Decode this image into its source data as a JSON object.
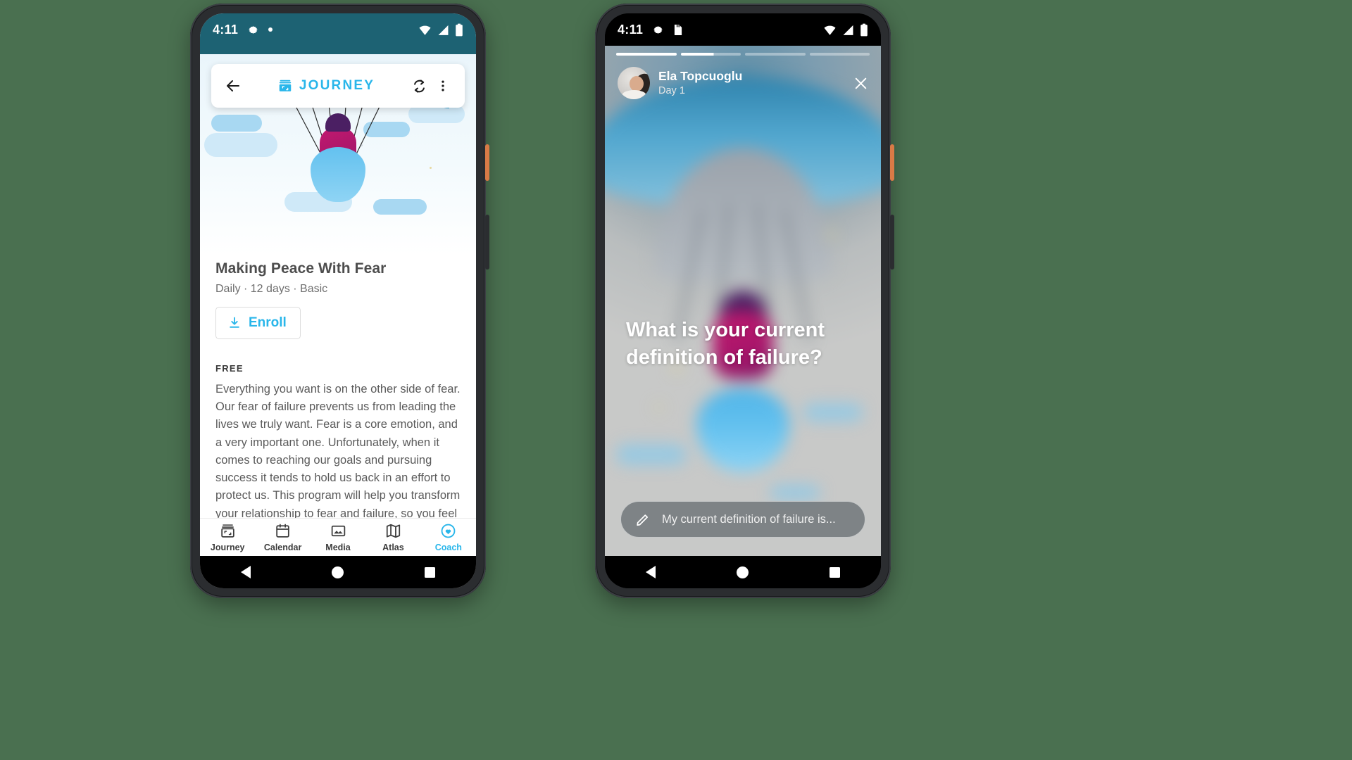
{
  "background_color": "#4a7050",
  "phone1": {
    "status_bar": {
      "time": "4:11",
      "icons": [
        "gear-icon",
        "dot-indicator"
      ],
      "right_icons": [
        "wifi-icon",
        "signal-icon",
        "battery-icon"
      ],
      "background_color": "#1d6273"
    },
    "app_bar": {
      "back_label": "back-arrow",
      "logo": "journey-box-icon",
      "title": "JOURNEY",
      "title_color": "#29b6ea",
      "sync_label": "sync-icon",
      "overflow_label": "more-vert-icon"
    },
    "course": {
      "title": "Making Peace With Fear",
      "meta": "Daily · 12 days · Basic",
      "enroll_label": "Enroll",
      "enroll_color": "#29b6ea",
      "free_tag": "FREE",
      "description": "Everything you want is on the other side of fear. Our fear of failure prevents us from leading the lives we truly want. Fear is a core emotion, and a very important one. Unfortunately, when it comes to reaching our goals and pursuing success it tends to hold us back in an effort to protect us. This program will help you transform your relationship to fear and failure, so you feel confident and empowered to take action towards what you want most."
    },
    "bottom_nav": {
      "active": "Coach",
      "active_color": "#29b6ea",
      "items": [
        {
          "label": "Journey",
          "icon": "journey-box-icon"
        },
        {
          "label": "Calendar",
          "icon": "calendar-icon"
        },
        {
          "label": "Media",
          "icon": "image-icon"
        },
        {
          "label": "Atlas",
          "icon": "map-icon"
        },
        {
          "label": "Coach",
          "icon": "heart-circle-icon"
        }
      ]
    },
    "system_nav": [
      "back-triangle-icon",
      "home-circle-icon",
      "recents-square-icon"
    ]
  },
  "phone2": {
    "status_bar": {
      "time": "4:11",
      "icons": [
        "gear-icon",
        "sd-card-icon"
      ],
      "right_icons": [
        "wifi-icon",
        "signal-icon",
        "battery-icon"
      ],
      "background_color": "#000000"
    },
    "story": {
      "progress": [
        {
          "state": "done"
        },
        {
          "state": "partial"
        },
        {
          "state": "empty"
        },
        {
          "state": "empty"
        }
      ],
      "author_name": "Ela Topcuoglu",
      "day_label": "Day 1",
      "close_label": "close-icon",
      "question": "What is your current definition of failure?",
      "reply_placeholder": "My current definition of failure is...",
      "reply_icon": "pencil-icon"
    },
    "system_nav": [
      "back-triangle-icon",
      "home-circle-icon",
      "recents-square-icon"
    ]
  }
}
